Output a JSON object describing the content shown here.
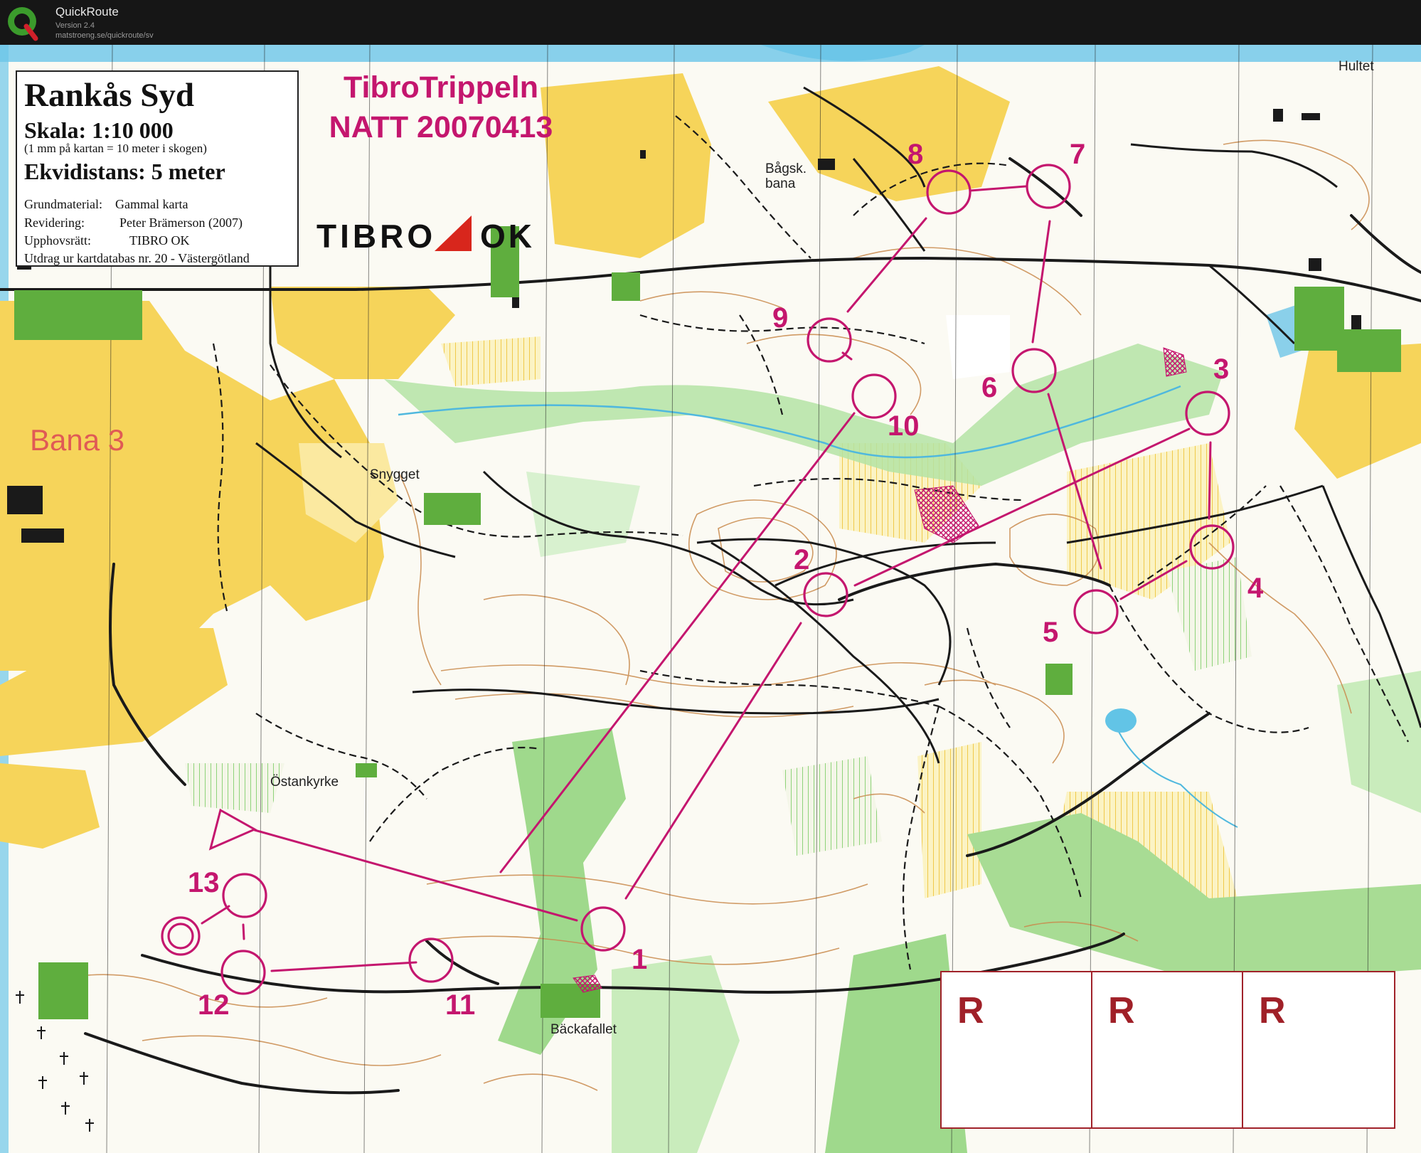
{
  "window": {
    "app_name": "QuickRoute",
    "version": "Version 2.4",
    "url": "matstroeng.se/quickroute/sv"
  },
  "legend": {
    "map_name": "Rankås Syd",
    "scale": "Skala:  1:10 000",
    "scale_note": "(1 mm på kartan = 10 meter i skogen)",
    "contour": "Ekvidistans:  5 meter",
    "rows": [
      {
        "label": "Grundmaterial:",
        "value": "Gammal karta"
      },
      {
        "label": "Revidering:",
        "value": "Peter Brämerson  (2007)"
      },
      {
        "label": "Upphovsrätt:",
        "value": "TIBRO OK"
      },
      {
        "label": "Utdrag ur kartdatabas nr. 20 - Västergötland",
        "value": ""
      }
    ]
  },
  "event": {
    "line1": "TibroTrippeln",
    "line2": "NATT 20070413"
  },
  "club_logo": {
    "left": "TIBRO",
    "right": "OK"
  },
  "course_label": "Bana 3",
  "place_names": [
    {
      "id": "hultet",
      "text": "Hultet"
    },
    {
      "id": "bagskbana-1",
      "text": "Bågsk."
    },
    {
      "id": "bagskbana-2",
      "text": "bana"
    },
    {
      "id": "snygget",
      "text": "Snygget"
    },
    {
      "id": "ostankyrke",
      "text": "Östankyrke"
    },
    {
      "id": "backafallet",
      "text": "Bäckafallet"
    }
  ],
  "controls": [
    {
      "number": "1"
    },
    {
      "number": "2"
    },
    {
      "number": "3"
    },
    {
      "number": "4"
    },
    {
      "number": "5"
    },
    {
      "number": "6"
    },
    {
      "number": "7"
    },
    {
      "number": "8"
    },
    {
      "number": "9"
    },
    {
      "number": "10"
    },
    {
      "number": "11"
    },
    {
      "number": "12"
    },
    {
      "number": "13"
    }
  ],
  "restricted_boxes": [
    "R",
    "R",
    "R"
  ],
  "colors": {
    "course": "#c4166e",
    "open_land": "#f6d45a",
    "forest_green": "#9fd98c",
    "water": "#62c4e6",
    "road": "#1a1a1a",
    "contour": "#c98a4c",
    "building_green": "#5fae3e"
  }
}
